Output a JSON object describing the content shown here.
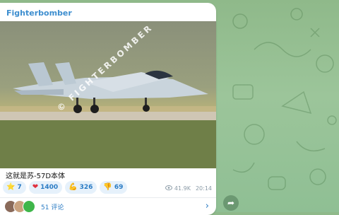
{
  "channel": {
    "name": "Fighterbomber"
  },
  "post": {
    "watermark": "© FIGHTERBOMBER",
    "caption": "这就是苏-57D本体",
    "reactions": [
      {
        "icon": "star-icon",
        "emoji": "⭐",
        "count": "7"
      },
      {
        "icon": "heart-icon",
        "emoji": "❤",
        "count": "1400"
      },
      {
        "icon": "flex-icon",
        "emoji": "💪",
        "count": "326"
      },
      {
        "icon": "thumbs-down-icon",
        "emoji": "👎",
        "count": "69"
      }
    ],
    "views": "41.9K",
    "time": "20:14"
  },
  "comments": {
    "label": "51 评论"
  },
  "colors": {
    "accent": "#2a7bc4",
    "channel": "#3d8ecf",
    "background": "#9cc59a"
  }
}
